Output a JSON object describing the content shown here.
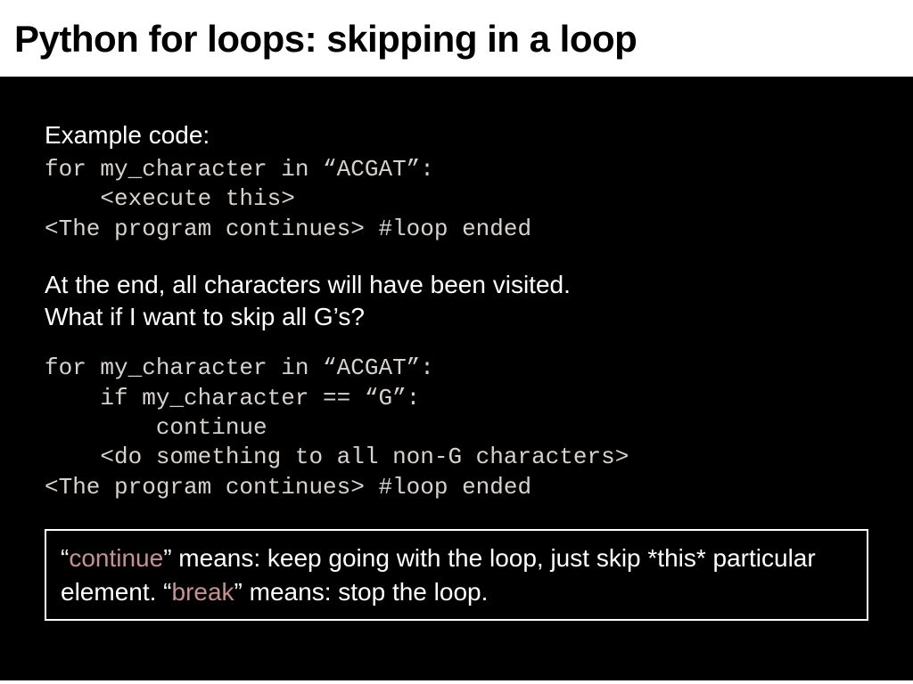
{
  "title": "Python for loops: skipping in a loop",
  "example_label": "Example code:",
  "code1": "for my_character in “ACGAT”:\n    <execute this>\n<The program continues> #loop ended",
  "para1": "At the end, all characters will have been visited.\nWhat if I want to skip all G’s?",
  "code2": "for my_character in “ACGAT”:\n    if my_character == “G”:\n        continue\n    <do something to all non-G characters>\n<The program continues> #loop ended",
  "summary": {
    "q1": "“",
    "kw1": "continue",
    "t1": "” means: keep going with the loop, just skip *this* particular element.  “",
    "kw2": "break",
    "t2": "” means: stop the loop."
  }
}
